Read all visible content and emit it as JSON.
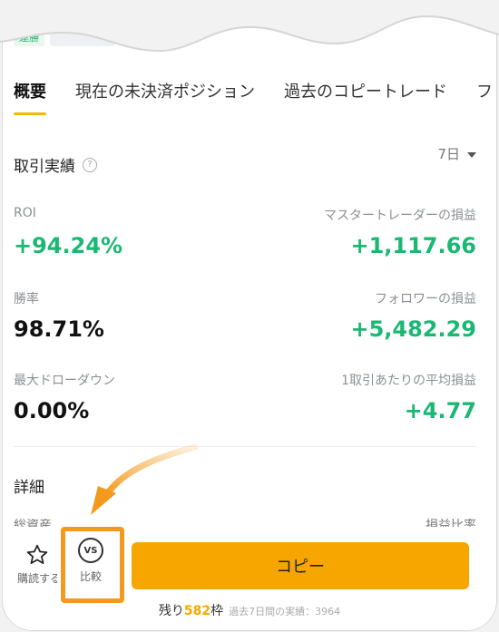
{
  "chips": [
    "連勝",
    ""
  ],
  "tabs": [
    "概要",
    "現在の未決済ポジション",
    "過去のコピートレード",
    "フ"
  ],
  "performance": {
    "title": "取引実績",
    "help_icon": "question-circle-icon",
    "period": "7日",
    "roi_label": "ROI",
    "roi_value": "+94.24%",
    "pnl_label": "マスタートレーダーの損益",
    "pnl_value": "+1,117.66",
    "winrate_label": "勝率",
    "winrate_value": "98.71%",
    "follower_pnl_label": "フォロワーの損益",
    "follower_pnl_value": "+5,482.29",
    "drawdown_label": "最大ドローダウン",
    "drawdown_value": "0.00%",
    "avg_pnl_label": "1取引あたりの平均損益",
    "avg_pnl_value": "+4.77"
  },
  "details": {
    "title": "詳細",
    "cut_left": "総資産",
    "cut_right": "損益比率"
  },
  "bottom": {
    "fav_label": "購読する",
    "fav_icon": "star-outline-icon",
    "compare_label": "比較",
    "compare_icon": "vs-icon",
    "copy_label": "コピー",
    "remain_prefix": "残り",
    "remain_count": "582",
    "remain_suffix": "枠",
    "remain_sub": "過去7日間の実績：3964"
  },
  "colors": {
    "accent": "#f7a600",
    "green": "#1bb873",
    "highlight": "#f39a1e"
  }
}
